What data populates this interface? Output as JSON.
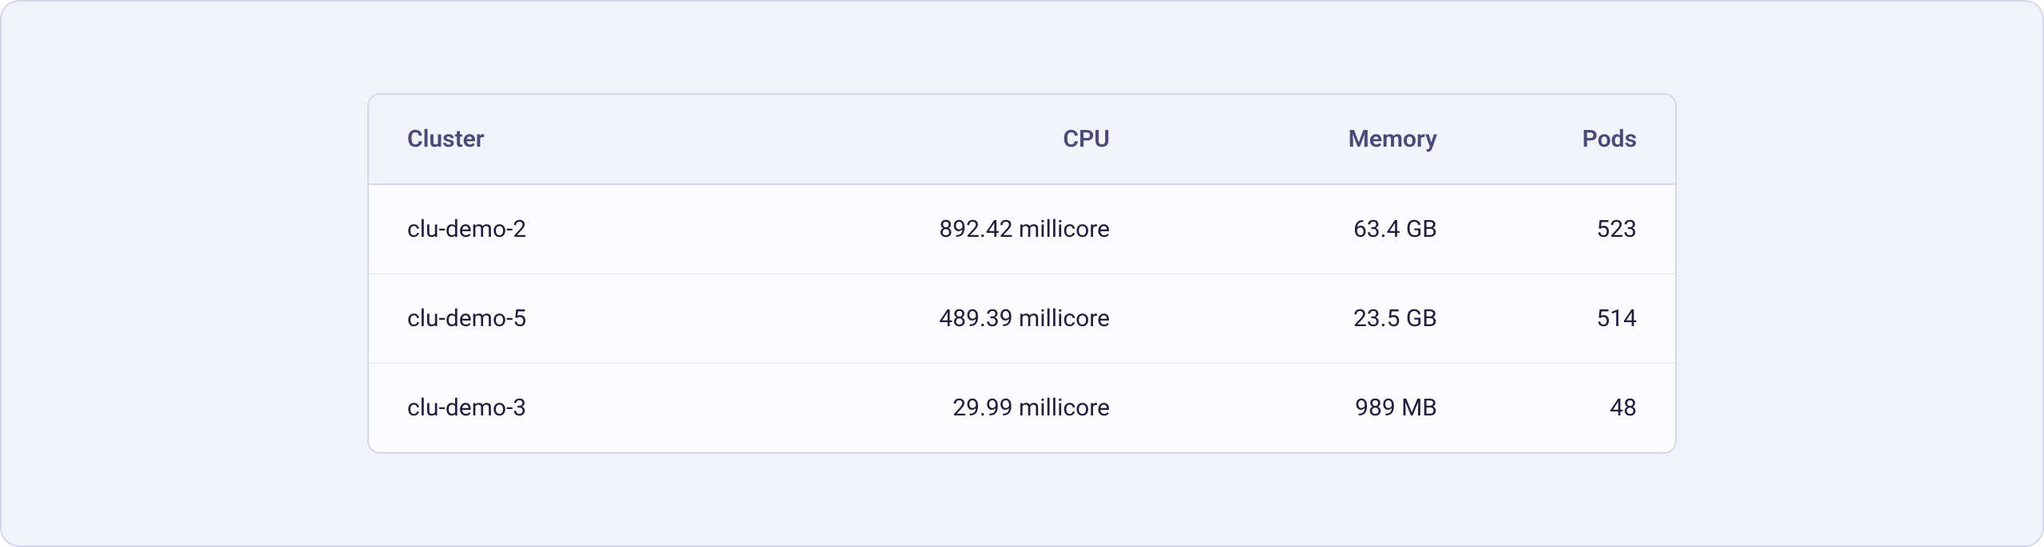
{
  "table": {
    "headers": {
      "cluster": "Cluster",
      "cpu": "CPU",
      "memory": "Memory",
      "pods": "Pods"
    },
    "rows": [
      {
        "cluster": "clu-demo-2",
        "cpu": "892.42 millicore",
        "memory": "63.4 GB",
        "pods": "523"
      },
      {
        "cluster": "clu-demo-5",
        "cpu": "489.39 millicore",
        "memory": "23.5 GB",
        "pods": "514"
      },
      {
        "cluster": "clu-demo-3",
        "cpu": "29.99 millicore",
        "memory": "989 MB",
        "pods": "48"
      }
    ]
  }
}
